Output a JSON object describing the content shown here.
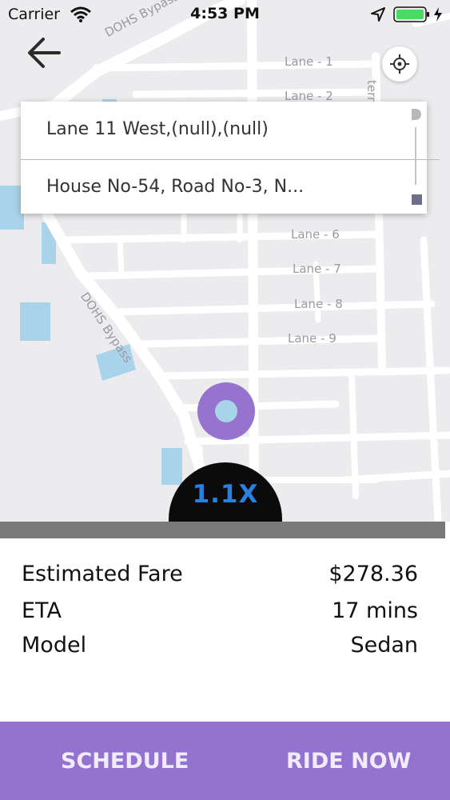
{
  "status_bar": {
    "carrier": "Carrier",
    "time": "4:53 PM"
  },
  "map": {
    "street_labels": {
      "dohs_bypass_top": "DOHS Bypass",
      "dohs_bypass_mid": "DOHS Bypass",
      "lane_1": "Lane - 1",
      "lane_2": "Lane - 2",
      "lane_6": "Lane - 6",
      "lane_7": "Lane - 7",
      "lane_8": "Lane - 8",
      "lane_9": "Lane - 9",
      "edge_partial": "terr"
    },
    "colors": {
      "background": "#ececee",
      "road": "#ffffff",
      "water": "#a9d3ea"
    }
  },
  "address_card": {
    "pickup": "Lane 11 West,(null),(null)",
    "dropoff": "House No-54, Road No-3, N..."
  },
  "surge": {
    "label": "1.1X"
  },
  "details": {
    "estimated_fare": {
      "label": "Estimated Fare",
      "value": "$278.36"
    },
    "eta": {
      "label": "ETA",
      "value": "17 mins"
    },
    "model": {
      "label": "Model",
      "value": "Sedan"
    }
  },
  "actions": {
    "schedule": "SCHEDULE",
    "ride_now": "RIDE NOW"
  },
  "icons": {
    "back": "arrow-left-icon",
    "locate": "crosshair-icon",
    "wifi": "wifi-icon",
    "location": "location-arrow-icon",
    "battery": "battery-icon",
    "charging": "charging-bolt-icon"
  },
  "colors": {
    "accent": "#9373cf",
    "marker": "#9673cf",
    "surge_text": "#2a7fe0",
    "surge_bg": "#0b0b0b",
    "battery_fill": "#4cd964"
  }
}
